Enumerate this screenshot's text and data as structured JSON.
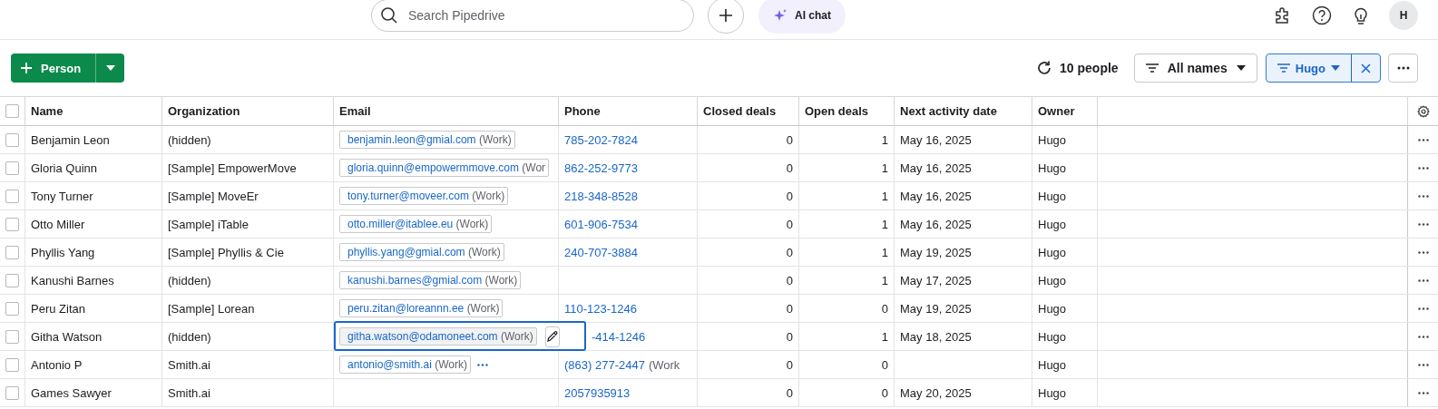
{
  "topbar": {
    "search": {
      "placeholder": "Search Pipedrive"
    },
    "ai_chat": "AI chat",
    "avatar": "H"
  },
  "toolbar": {
    "add_button": "Person",
    "count": "10 people",
    "name_filter": "All names",
    "owner_filter": {
      "label": "Hugo",
      "active": true
    }
  },
  "table": {
    "all_checked": false,
    "columns": [
      "Name",
      "Organization",
      "Email",
      "Phone",
      "Closed deals",
      "Open deals",
      "Next activity date",
      "Owner"
    ],
    "rows": [
      {
        "checked": false,
        "name": "Benjamin Leon",
        "organization": "(hidden)",
        "email": "benjamin.leon@gmial.com",
        "email_type": "(Work)",
        "more_emails": false,
        "editing": false,
        "phone": "785-202-7824",
        "closed_deals": "0",
        "open_deals": "1",
        "next_activity": "May 16, 2025",
        "owner": "Hugo"
      },
      {
        "checked": false,
        "name": "Gloria Quinn",
        "organization": "[Sample] EmpowerMove",
        "email": "gloria.quinn@empowermmove.com",
        "email_type": "(Wor",
        "more_emails": false,
        "editing": false,
        "phone": "862-252-9773",
        "closed_deals": "0",
        "open_deals": "1",
        "next_activity": "May 16, 2025",
        "owner": "Hugo"
      },
      {
        "checked": false,
        "name": "Tony Turner",
        "organization": "[Sample] MoveEr",
        "email": "tony.turner@moveer.com",
        "email_type": "(Work)",
        "more_emails": false,
        "editing": false,
        "phone": "218-348-8528",
        "closed_deals": "0",
        "open_deals": "1",
        "next_activity": "May 16, 2025",
        "owner": "Hugo"
      },
      {
        "checked": false,
        "name": "Otto Miller",
        "organization": "[Sample] iTable",
        "email": "otto.miller@itablee.eu",
        "email_type": "(Work)",
        "more_emails": false,
        "editing": false,
        "phone": "601-906-7534",
        "closed_deals": "0",
        "open_deals": "1",
        "next_activity": "May 16, 2025",
        "owner": "Hugo"
      },
      {
        "checked": false,
        "name": "Phyllis Yang",
        "organization": "[Sample] Phyllis & Cie",
        "email": "phyllis.yang@gmial.com",
        "email_type": "(Work)",
        "more_emails": false,
        "editing": false,
        "phone": "240-707-3884",
        "closed_deals": "0",
        "open_deals": "1",
        "next_activity": "May 19, 2025",
        "owner": "Hugo"
      },
      {
        "checked": false,
        "name": "Kanushi Barnes",
        "organization": "(hidden)",
        "email": "kanushi.barnes@gmial.com",
        "email_type": "(Work)",
        "more_emails": false,
        "editing": false,
        "closed_deals": "0",
        "open_deals": "1",
        "next_activity": "May 17, 2025",
        "owner": "Hugo"
      },
      {
        "checked": false,
        "name": "Peru Zitan",
        "organization": "[Sample] Lorean",
        "email": "peru.zitan@loreannn.ee",
        "email_type": "(Work)",
        "more_emails": false,
        "editing": false,
        "phone": "110-123-1246",
        "closed_deals": "0",
        "open_deals": "0",
        "next_activity": "May 19, 2025",
        "owner": "Hugo"
      },
      {
        "checked": false,
        "name": "Githa Watson",
        "organization": "(hidden)",
        "email": "githa.watson@odamoneet.com",
        "email_type": "(Work)",
        "more_emails": false,
        "editing": true,
        "phone": "-414-1246",
        "closed_deals": "0",
        "open_deals": "1",
        "next_activity": "May 18, 2025",
        "owner": "Hugo"
      },
      {
        "checked": false,
        "name": "Antonio P",
        "organization": "Smith.ai",
        "email": "antonio@smith.ai",
        "email_type": "(Work)",
        "more_emails": true,
        "editing": false,
        "phone": "(863) 277-2447",
        "phone_type": "(Work",
        "closed_deals": "0",
        "open_deals": "0",
        "owner": "Hugo"
      },
      {
        "checked": false,
        "name": "Games Sawyer",
        "organization": "Smith.ai",
        "more_emails": false,
        "editing": false,
        "phone": "2057935913",
        "closed_deals": "0",
        "open_deals": "0",
        "next_activity": "May 20, 2025",
        "owner": "Hugo"
      }
    ]
  }
}
